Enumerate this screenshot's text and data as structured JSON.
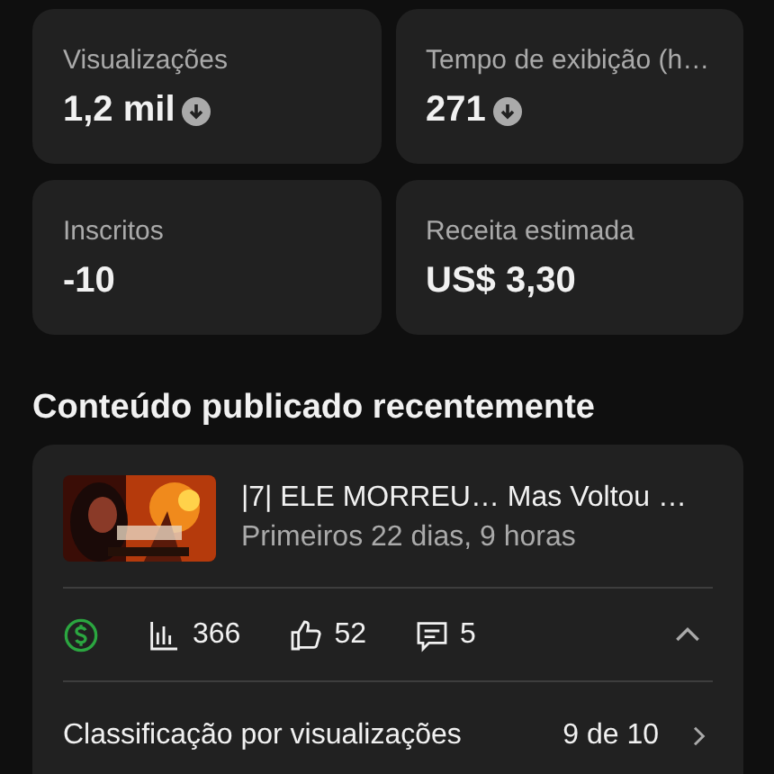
{
  "metrics": [
    {
      "label": "Visualizações",
      "value": "1,2 mil",
      "trend_down": true
    },
    {
      "label": "Tempo de exibição (h…",
      "value": "271",
      "trend_down": true
    },
    {
      "label": "Inscritos",
      "value": "-10",
      "trend_down": false
    },
    {
      "label": "Receita estimada",
      "value": "US$ 3,30",
      "trend_down": false
    }
  ],
  "section_title": "Conteúdo publicado recentemente",
  "video": {
    "title": "|7| ELE MORREU… Mas Voltou …",
    "subtitle": "Primeiros 22 dias, 9 horas",
    "monetized": true,
    "stats": [
      {
        "kind": "views",
        "value": "366"
      },
      {
        "kind": "likes",
        "value": "52"
      },
      {
        "kind": "comments",
        "value": "5"
      }
    ],
    "expanded": true,
    "ranking": {
      "label": "Classificação por visualizações",
      "value": "9 de 10"
    }
  }
}
